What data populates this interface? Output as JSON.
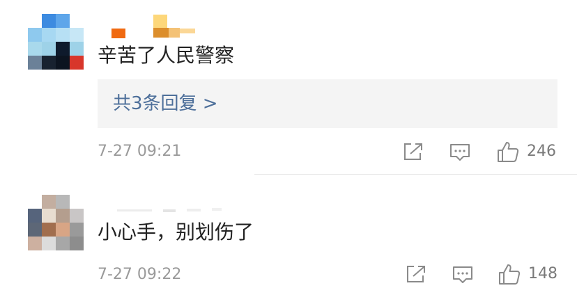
{
  "comments": [
    {
      "text": "辛苦了人民警察",
      "replies_label": "共3条回复 >",
      "time": "7-27 09:21",
      "likes": "246",
      "avatar_colors": [
        "#ffffff",
        "#3d8be0",
        "#5ea6ea",
        "#ffffff",
        "#8ec9ee",
        "#a7d8f2",
        "#b7e0f4",
        "#c7e7f6",
        "#a9d9ec",
        "#9ed2e8",
        "#0e1a2c",
        "#9ed2e8",
        "#6b8198",
        "#182230",
        "#0c1420",
        "#d8362b"
      ]
    },
    {
      "text": "小心手，别划伤了",
      "time": "7-27 09:22",
      "likes": "148",
      "avatar_colors": [
        "#ffffff",
        "#c3aea0",
        "#b8b8b8",
        "#ffffff",
        "#56647c",
        "#e8ddd0",
        "#b49e8e",
        "#c9c6c6",
        "#5d6777",
        "#a16e4e",
        "#d8a585",
        "#9a9a9a",
        "#cdb0a0",
        "#dcdcdc",
        "#a7a7a7",
        "#8d8d8d"
      ]
    }
  ]
}
